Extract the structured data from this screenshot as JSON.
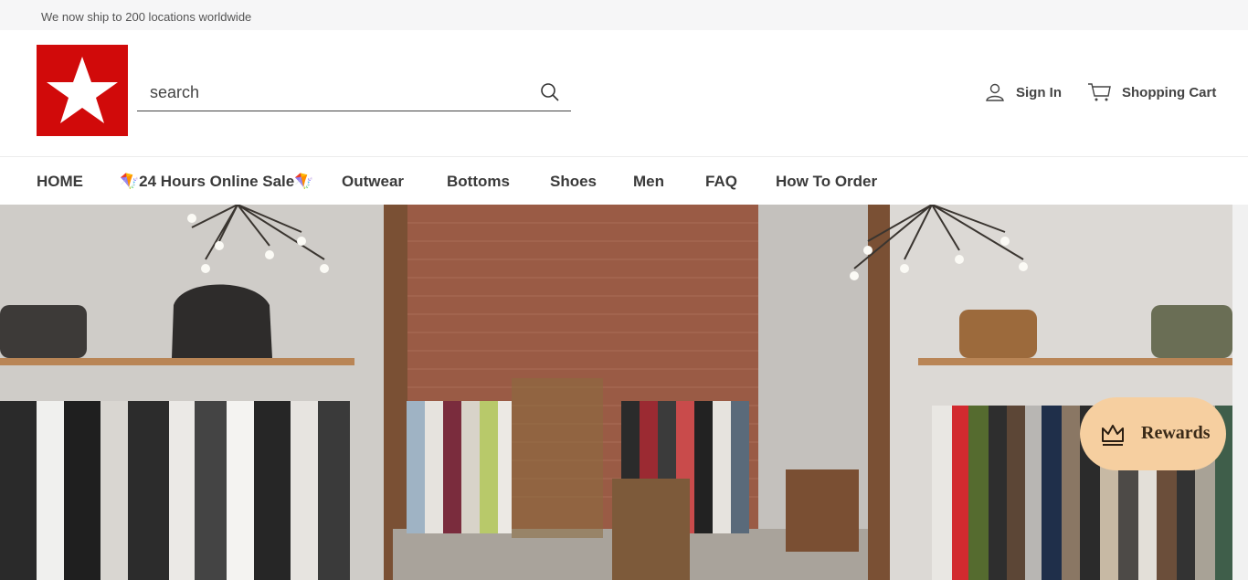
{
  "announcement": "We now ship to 200 locations worldwide",
  "search": {
    "placeholder": "search"
  },
  "header": {
    "sign_in": "Sign In",
    "cart": "Shopping Cart"
  },
  "nav": {
    "items": [
      "HOME",
      "🪁24 Hours Online Sale🪁",
      "Outwear",
      "Bottoms",
      "Shoes",
      "Men",
      "FAQ",
      "How To Order"
    ]
  },
  "rewards": {
    "label": "Rewards"
  },
  "colors": {
    "brand_red": "#d10a0a",
    "rewards_bg": "#f6cfa0",
    "text_dark": "#3a3a3a"
  }
}
